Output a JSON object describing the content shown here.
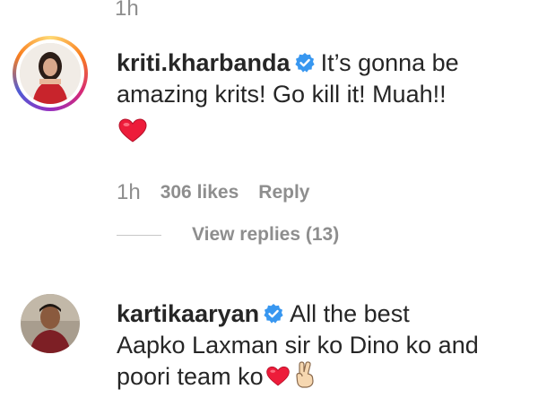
{
  "top_comment": {
    "time": "1h"
  },
  "comments": [
    {
      "username": "kriti.kharbanda",
      "line1": "It’s gonna be",
      "line2": "amazing krits! Go kill it! Muah!!",
      "time": "1h",
      "likes": "306 likes",
      "reply_label": "Reply",
      "view_replies": "View replies (13)"
    },
    {
      "username": "kartikaaryan",
      "line1": "All the best",
      "line2": "Aapko Laxman sir ko Dino ko and",
      "line3": "poori team ko"
    }
  ],
  "colors": {
    "verified": "#3897f0",
    "heart": "#ed1c3a",
    "muted": "#8e8e8e"
  },
  "icons": [
    "verified-badge-icon",
    "red-heart-emoji-icon",
    "victory-hand-emoji-icon"
  ]
}
